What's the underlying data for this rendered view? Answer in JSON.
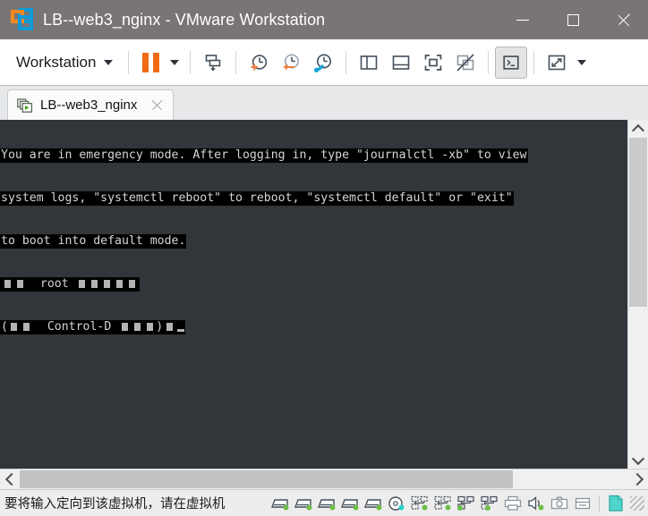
{
  "window": {
    "title": "LB--web3_nginx - VMware Workstation",
    "logo_icon": "vmware-logo-icon",
    "controls": {
      "minimize": "minimize-button",
      "maximize": "maximize-button",
      "close": "close-button"
    }
  },
  "toolbar": {
    "menu_label": "Workstation",
    "menu_caret": "chevron-down-icon",
    "power_icon": "pause-icon",
    "power_caret": "chevron-down-icon",
    "buttons": [
      {
        "name": "send-ctrl-alt-del-button",
        "icon": "send-key-icon"
      },
      {
        "name": "take-snapshot-button",
        "icon": "snapshot-add-icon"
      },
      {
        "name": "revert-snapshot-button",
        "icon": "snapshot-revert-icon"
      },
      {
        "name": "snapshot-manager-button",
        "icon": "snapshot-manager-icon"
      },
      {
        "name": "show-library-button",
        "icon": "library-panel-icon"
      },
      {
        "name": "show-thumbnail-bar-button",
        "icon": "thumbnail-bar-icon"
      },
      {
        "name": "enter-full-screen-button",
        "icon": "full-screen-icon"
      },
      {
        "name": "unity-mode-button",
        "icon": "unity-mode-disabled-icon"
      },
      {
        "name": "console-view-button",
        "icon": "console-view-icon",
        "active": true
      },
      {
        "name": "stretch-guest-button",
        "icon": "stretch-fit-icon"
      }
    ],
    "stretch_caret": "chevron-down-icon"
  },
  "tab": {
    "label": "LB--web3_nginx",
    "icon": "vm-running-icon",
    "close_icon": "close-icon"
  },
  "console": {
    "lines": [
      "You are in emergency mode. After logging in, type \"journalctl -xb\" to view",
      "system logs, \"systemctl reboot\" to reboot, \"systemctl default\" or \"exit\"",
      "to boot into default mode."
    ],
    "prompt_line_prefix": "root",
    "prompt_line_suffix": "Control-D",
    "prompt_open_paren": "(",
    "prompt_close_paren": ")"
  },
  "scrollbars": {
    "vertical": {
      "up_icon": "chevron-up-icon",
      "down_icon": "chevron-down-icon",
      "thumb_size_percent": 54,
      "thumb_position_percent": 0
    },
    "horizontal": {
      "left_icon": "chevron-left-icon",
      "right_icon": "chevron-right-icon",
      "thumb_size_percent": 81,
      "thumb_position_percent": 0
    }
  },
  "statusbar": {
    "message": "要将输入定向到该虚拟机，请在虚拟机",
    "devices": [
      {
        "name": "status-hard-disk-1",
        "icon": "hard-disk-icon",
        "state": "connected"
      },
      {
        "name": "status-hard-disk-2",
        "icon": "hard-disk-icon",
        "state": "connected"
      },
      {
        "name": "status-hard-disk-3",
        "icon": "hard-disk-icon",
        "state": "connected"
      },
      {
        "name": "status-hard-disk-4",
        "icon": "hard-disk-icon",
        "state": "connected"
      },
      {
        "name": "status-hard-disk-5",
        "icon": "hard-disk-icon",
        "state": "connected"
      },
      {
        "name": "status-cd-dvd",
        "icon": "cd-dvd-icon",
        "state": "connected"
      },
      {
        "name": "status-network-adapter-1",
        "icon": "network-adapter-icon",
        "state": "connected"
      },
      {
        "name": "status-network-adapter-2",
        "icon": "network-adapter-icon",
        "state": "connected"
      },
      {
        "name": "status-network-adapter-3",
        "icon": "network-adapter-icon",
        "state": "connected"
      },
      {
        "name": "status-network-adapter-4",
        "icon": "network-adapter-icon",
        "state": "connected"
      },
      {
        "name": "status-printer",
        "icon": "printer-icon",
        "state": "disconnected"
      },
      {
        "name": "status-sound-card",
        "icon": "sound-icon",
        "state": "connected"
      },
      {
        "name": "status-camera",
        "icon": "camera-icon",
        "state": "disconnected"
      },
      {
        "name": "status-usb-device",
        "icon": "usb-device-icon",
        "state": "disconnected"
      },
      {
        "name": "status-message-log",
        "icon": "message-log-icon",
        "state": "highlighted"
      }
    ],
    "resize_grip": "resize-grip-icon"
  },
  "colors": {
    "titlebar_bg": "#7a7574",
    "accent_orange": "#f06b16",
    "accent_blue": "#0c9ad9",
    "toolbar_bg": "#ffffff",
    "vm_bg": "#32363a",
    "console_bg": "#000000",
    "console_fg": "#d6d6d6",
    "device_green": "#6cc04a",
    "device_cyan": "#2ad2c9",
    "statusbar_bg": "#ededed"
  }
}
